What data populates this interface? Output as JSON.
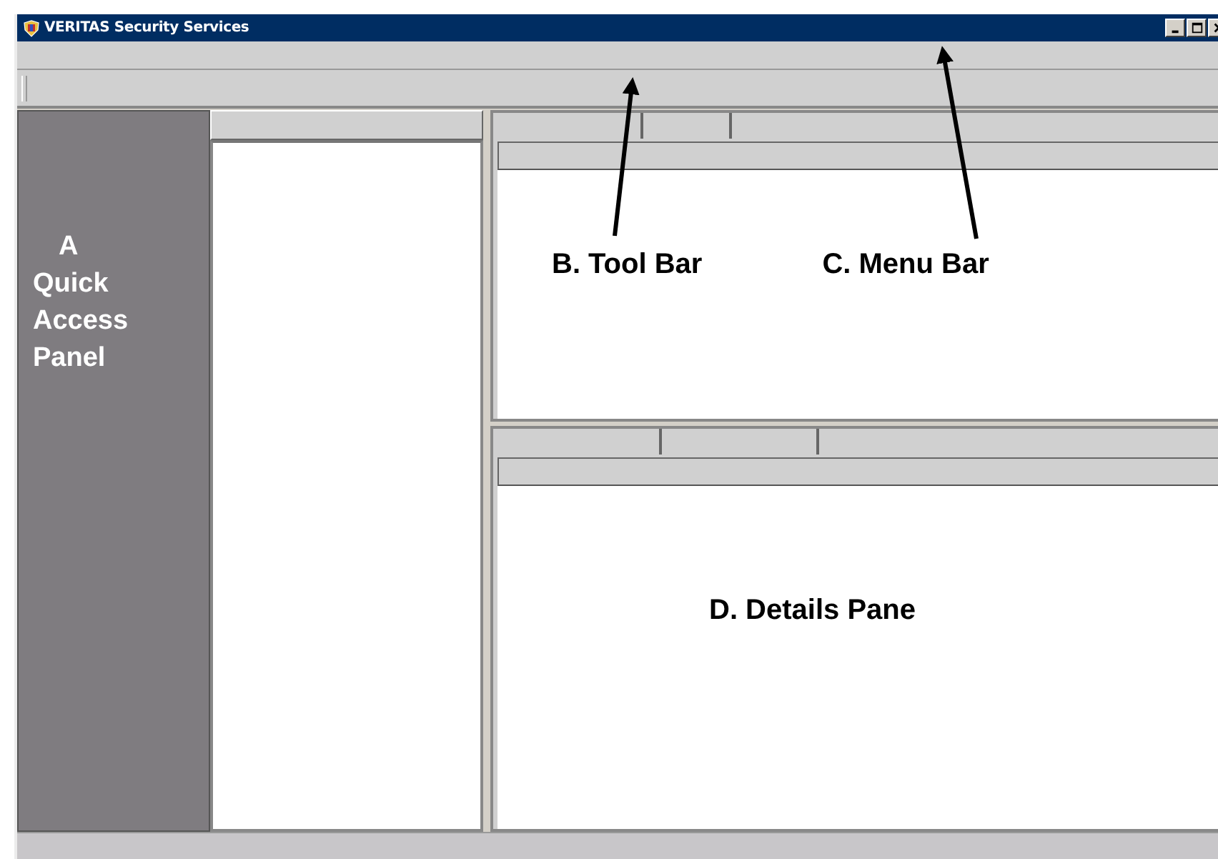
{
  "window": {
    "title": "VERITAS Security Services"
  },
  "quick_access_panel": {
    "label_lines": [
      "A",
      "Quick",
      "Access",
      "Panel"
    ]
  },
  "callouts": [
    {
      "label": "B. Tool Bar"
    },
    {
      "label": "C. Menu Bar"
    }
  ],
  "details_pane": {
    "label": "D. Details Pane"
  }
}
